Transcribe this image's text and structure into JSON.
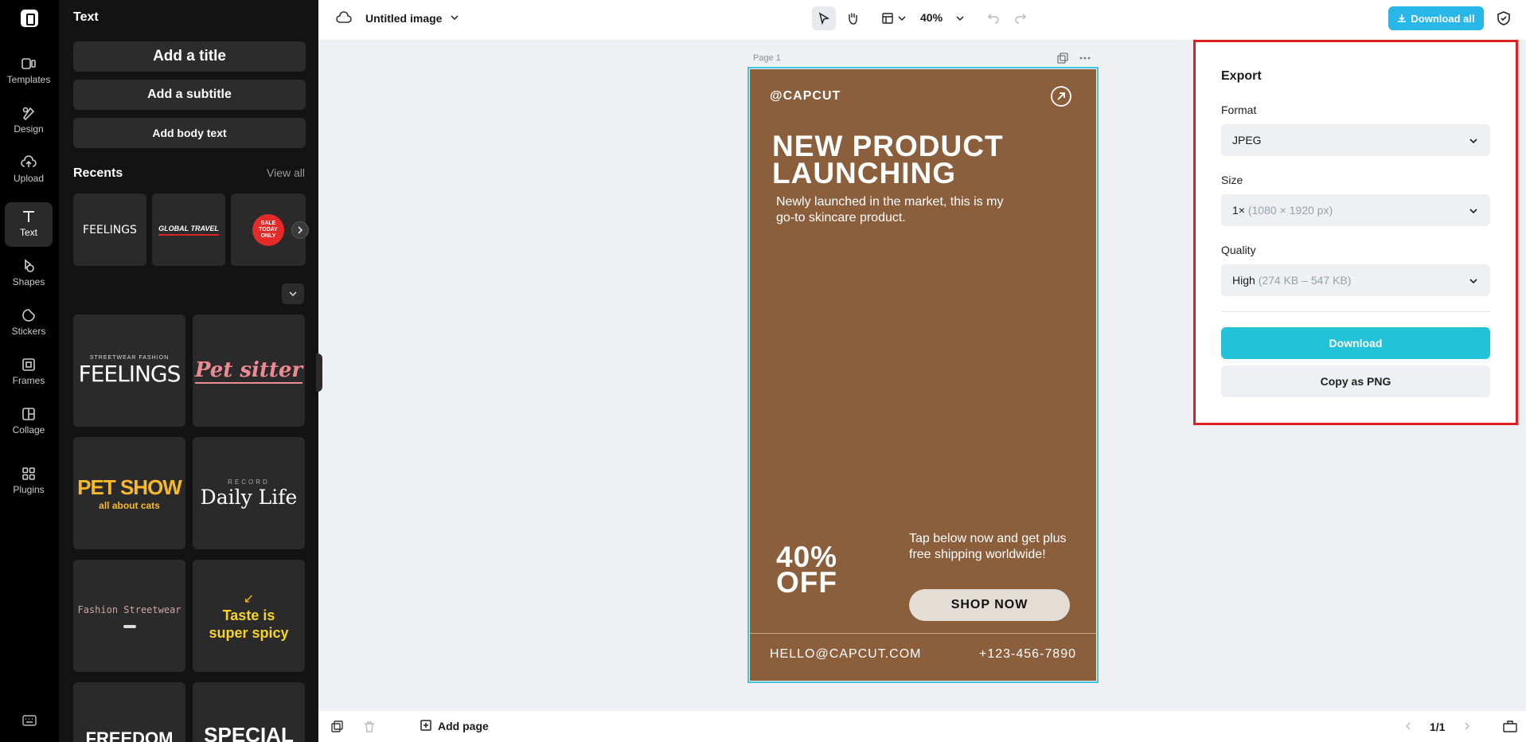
{
  "rail": {
    "items": [
      {
        "label": "Templates",
        "icon": "templates-icon"
      },
      {
        "label": "Design",
        "icon": "design-icon"
      },
      {
        "label": "Upload",
        "icon": "upload-icon"
      },
      {
        "label": "Text",
        "icon": "text-icon",
        "active": true
      },
      {
        "label": "Shapes",
        "icon": "shapes-icon"
      },
      {
        "label": "Stickers",
        "icon": "stickers-icon"
      },
      {
        "label": "Frames",
        "icon": "frames-icon"
      },
      {
        "label": "Collage",
        "icon": "collage-icon"
      },
      {
        "label": "Plugins",
        "icon": "plugins-icon"
      }
    ]
  },
  "panel": {
    "title": "Text",
    "add_title": "Add a title",
    "add_subtitle": "Add a subtitle",
    "add_body": "Add body text",
    "recents_label": "Recents",
    "view_all": "View all",
    "recents": [
      {
        "text": "FEELINGS"
      },
      {
        "text": "GLOBAL TRAVEL"
      },
      {
        "text": "SALE TODAY ONLY"
      }
    ],
    "tiles": [
      {
        "top": "STREETWEAR FASHION",
        "main": "FEELINGS"
      },
      {
        "main": "Pet sitter"
      },
      {
        "main": "PET SHOW",
        "sub": "all about cats"
      },
      {
        "top": "RECORD",
        "main": "Daily Life"
      },
      {
        "main": "Fashion Streetwear"
      },
      {
        "main": "Taste is super spicy"
      },
      {
        "main": "FREEDOM"
      },
      {
        "main": "SPECIAL"
      }
    ]
  },
  "topbar": {
    "doc_title": "Untitled image",
    "zoom": "40%",
    "download_all": "Download all"
  },
  "canvas": {
    "page_label": "Page 1",
    "poster": {
      "handle": "@CAPCUT",
      "headline_1": "NEW PRODUCT",
      "headline_2": "LAUNCHING",
      "sub": "Newly launched in the market, this is my go-to skincare product.",
      "off_1": "40%",
      "off_2": "OFF",
      "tap": "Tap below now and get plus free shipping worldwide!",
      "shop": "SHOP NOW",
      "email": "HELLO@CAPCUT.COM",
      "phone": "+123-456-7890",
      "bg_color": "#8b5e3c"
    }
  },
  "export": {
    "title": "Export",
    "format_label": "Format",
    "format_value": "JPEG",
    "size_label": "Size",
    "size_value": "1×",
    "size_detail": "(1080 × 1920 px)",
    "quality_label": "Quality",
    "quality_value": "High",
    "quality_detail": "(274 KB – 547 KB)",
    "download": "Download",
    "copy_png": "Copy as PNG",
    "accent": "#22c3d8"
  },
  "bottombar": {
    "add_page": "Add page",
    "pager": "1/1"
  }
}
